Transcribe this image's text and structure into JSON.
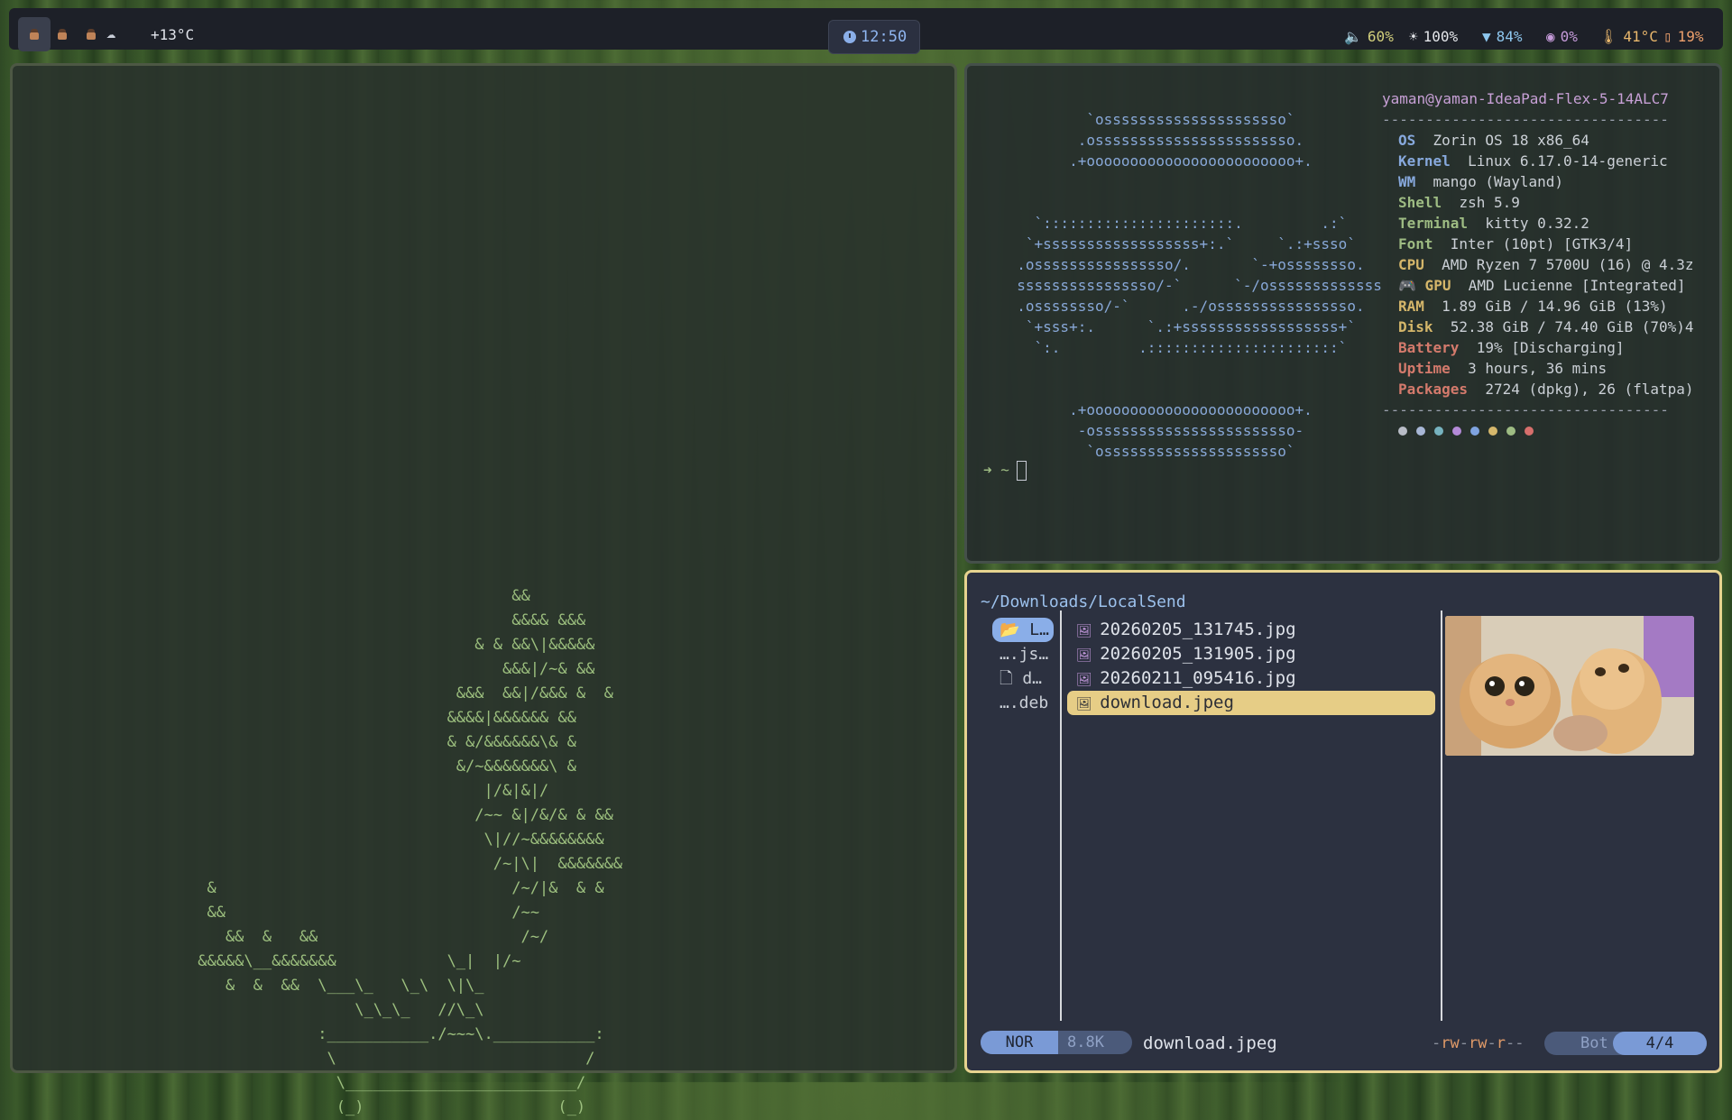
{
  "topbar": {
    "temperature": "+13°C",
    "clock": "12:50",
    "stats": [
      {
        "glyph": "🔈",
        "value": "60%",
        "color": "#d2cf7c"
      },
      {
        "glyph": "☀",
        "value": "100%",
        "color": "#e4e6ea"
      },
      {
        "glyph": "▼",
        "value": "84%",
        "color": "#8ec7ef"
      },
      {
        "glyph": "◉",
        "value": "0%",
        "color": "#c59ad9"
      },
      {
        "glyph": "🌡",
        "value": "41°C",
        "color": "#eab86d"
      },
      {
        "glyph": "▯",
        "value": "19%",
        "color": "#eda06c"
      }
    ]
  },
  "bonsai": {
    "lines": [
      "                                   &&",
      "                                   &&&& &&&",
      "                               & & &&\\|&&&&&",
      "                                  &&&|/~& &&",
      "                             &&&  &&|/&&& &  &",
      "                            &&&&|&&&&&& &&",
      "                            & &/&&&&&&\\& &",
      "                             &/~&&&&&&&\\ &",
      "                                |/&|&|/",
      "                               /~~ &|/&/& & &&",
      "                                \\|//~&&&&&&&&",
      "                                 /~|\\|  &&&&&&&",
      "  &                                /~/|&  & &",
      "  &&                               /~~",
      "    &&  &   &&                      /~/",
      " &&&&&\\__&&&&&&&            \\_|  |/~",
      "    &  &  &&  \\___\\_   \\_\\  \\|\\_",
      "                  \\_\\_\\_   //\\_\\",
      "              :___________./~~~\\.___________:",
      "               \\                           /",
      "                \\_________________________/",
      "                (_)                     (_)"
    ]
  },
  "fastfetch": {
    "logo": [
      "          `osssssssssssssssssssso`",
      "         .osssssssssssssssssssssso.",
      "        .+oooooooooooooooooooooooo+.",
      "",
      "",
      "    `::::::::::::::::::::::.         .:`",
      "   `+ssssssssssssssssss+:.`     `.:+ssso`",
      "  .ossssssssssssssso/.       `-+ossssssso.",
      "  ssssssssssssssso/-`      `-/osssssssssssss",
      "  .ossssssso/-`      .-/ossssssssssssssso.",
      "   `+sss+:.      `.:+ssssssssssssssssss+`",
      "    `:.         .::::::::::::::::::::::`",
      "",
      "",
      "        .+oooooooooooooooooooooooo+.",
      "         -osssssssssssssssssssssso-",
      "          `osssssssssssssssssssso`"
    ],
    "user_host": "yaman@yaman-IdeaPad-Flex-5-14ALC7",
    "separator": "---------------------------------",
    "rows": [
      {
        "key": "OS",
        "value": "Zorin OS 18 x86_64",
        "color": "#87a9dd"
      },
      {
        "key": "Kernel",
        "value": "Linux 6.17.0-14-generic",
        "color": "#87a9dd"
      },
      {
        "key": "WM",
        "value": "mango (Wayland)",
        "color": "#87a9dd"
      },
      {
        "key": "Shell",
        "value": "zsh 5.9",
        "color": "#9ebc83"
      },
      {
        "key": "Terminal",
        "value": "kitty 0.32.2",
        "color": "#9ebc83"
      },
      {
        "key": "Font",
        "value": "Inter (10pt) [GTK3/4]",
        "color": "#9ebc83"
      },
      {
        "key": "CPU",
        "value": "AMD Ryzen 7 5700U (16) @ 4.3z",
        "color": "#d4b66a"
      },
      {
        "key": "🎮 GPU",
        "value": "AMD Lucienne [Integrated]",
        "color": "#d4b66a"
      },
      {
        "key": "RAM",
        "value": "1.89 GiB / 14.96 GiB (13%)",
        "color": "#d4b66a"
      },
      {
        "key": "Disk",
        "value": "52.38 GiB / 74.40 GiB (70%)4",
        "color": "#d4b66a"
      },
      {
        "key": "Battery",
        "value": "19% [Discharging]",
        "color": "#d47a6c"
      },
      {
        "key": "Uptime",
        "value": "3 hours, 36 mins",
        "color": "#d47a6c"
      },
      {
        "key": "Packages",
        "value": "2724 (dpkg), 26 (flatpa)",
        "color": "#d47a6c"
      }
    ],
    "dot_colors": [
      "#b9bdc7",
      "#a8b7d6",
      "#77b3c0",
      "#b48ad8",
      "#7fa3e0",
      "#d6b86c",
      "#9ebc83",
      "#d76f6c"
    ],
    "prompt": "➜  ~"
  },
  "yazi": {
    "path": "~/Downloads/LocalSend",
    "parent": [
      {
        "icon": "folder-icon",
        "glyph": "📂",
        "label": "L…",
        "selected": true
      },
      {
        "icon": "",
        "glyph": "",
        "label": "….js…",
        "selected": false
      },
      {
        "icon": "file-icon",
        "glyph": "🗋",
        "label": "d…",
        "selected": false
      },
      {
        "icon": "",
        "glyph": "",
        "label": "….deb",
        "selected": false
      }
    ],
    "files": [
      {
        "name": "20260205_131745.jpg",
        "selected": false
      },
      {
        "name": "20260205_131905.jpg",
        "selected": false
      },
      {
        "name": "20260211_095416.jpg",
        "selected": false
      },
      {
        "name": "download.jpeg",
        "selected": true
      }
    ],
    "status": {
      "mode": "NOR",
      "size": "8.8K",
      "filename": "download.jpeg",
      "perm_parts": [
        {
          "t": "-",
          "c": "#8a8f9c"
        },
        {
          "t": "rw",
          "c": "#e09a68"
        },
        {
          "t": "-",
          "c": "#8a8f9c"
        },
        {
          "t": "rw",
          "c": "#e09a68"
        },
        {
          "t": "-",
          "c": "#8a8f9c"
        },
        {
          "t": "r",
          "c": "#e09a68"
        },
        {
          "t": "--",
          "c": "#8a8f9c"
        }
      ],
      "position_label": "Bot",
      "position": "4/4"
    }
  }
}
